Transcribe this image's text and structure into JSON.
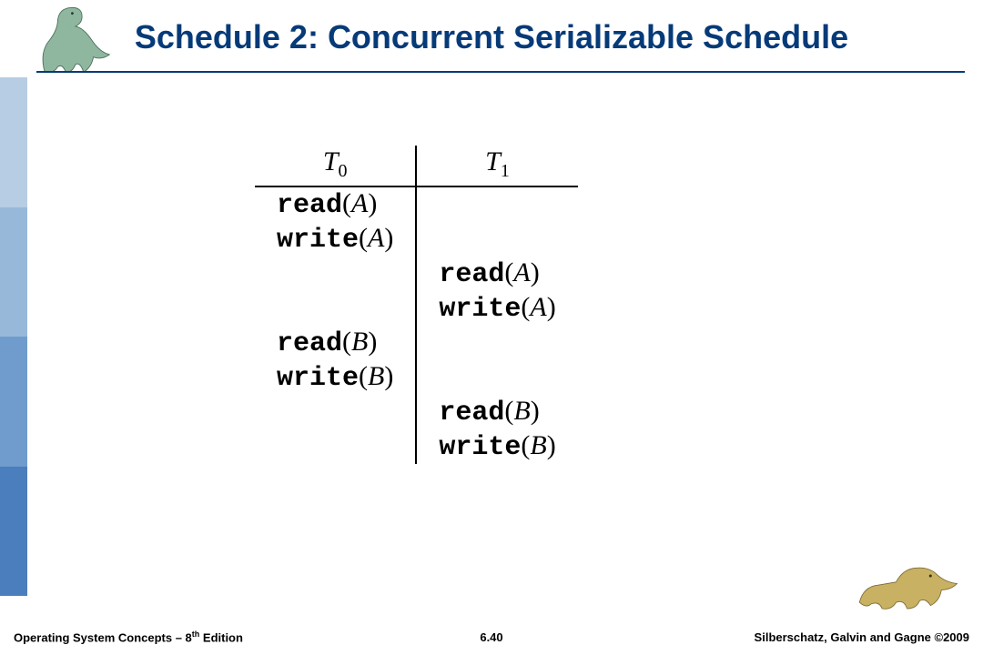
{
  "title": "Schedule 2: Concurrent Serializable Schedule",
  "table": {
    "headers": {
      "t0": "T",
      "t0sub": "0",
      "t1": "T",
      "t1sub": "1"
    },
    "rows": [
      {
        "t0_op": "read",
        "t0_arg": "A",
        "t1_op": "",
        "t1_arg": ""
      },
      {
        "t0_op": "write",
        "t0_arg": "A",
        "t1_op": "",
        "t1_arg": ""
      },
      {
        "t0_op": "",
        "t0_arg": "",
        "t1_op": "read",
        "t1_arg": "A"
      },
      {
        "t0_op": "",
        "t0_arg": "",
        "t1_op": "write",
        "t1_arg": "A"
      },
      {
        "t0_op": "read",
        "t0_arg": "B",
        "t1_op": "",
        "t1_arg": ""
      },
      {
        "t0_op": "write",
        "t0_arg": "B",
        "t1_op": "",
        "t1_arg": ""
      },
      {
        "t0_op": "",
        "t0_arg": "",
        "t1_op": "read",
        "t1_arg": "B"
      },
      {
        "t0_op": "",
        "t0_arg": "",
        "t1_op": "write",
        "t1_arg": "B"
      }
    ]
  },
  "footer": {
    "left_pre": "Operating System Concepts – 8",
    "left_sup": "th",
    "left_post": " Edition",
    "center": "6.40",
    "right": "Silberschatz, Galvin and Gagne ©2009"
  }
}
